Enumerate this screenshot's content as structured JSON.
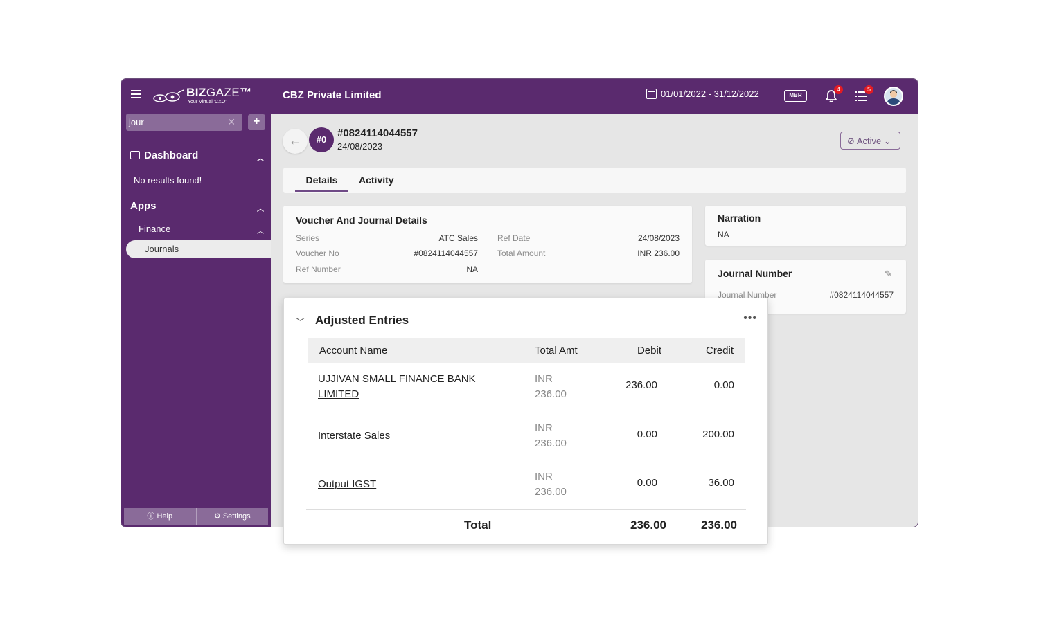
{
  "header": {
    "company": "CBZ Private Limited",
    "date_range": "01/01/2022 - 31/12/2022",
    "mbr_label": "MBR",
    "notif_count": "4",
    "tasks_count": "5",
    "logo_text_bold": "BIZ",
    "logo_text_thin": "GAZE",
    "logo_tagline": "Your Virtual 'CXO'"
  },
  "sidebar": {
    "search_value": "jour",
    "dashboard_label": "Dashboard",
    "no_results": "No results found!",
    "apps_label": "Apps",
    "finance_label": "Finance",
    "journals_label": "Journals",
    "help_label": "Help",
    "settings_label": "Settings"
  },
  "voucher": {
    "badge": "#0",
    "number": "#0824114044557",
    "date": "24/08/2023",
    "status": "Active"
  },
  "tabs": [
    "Details",
    "Activity"
  ],
  "details_card": {
    "title": "Voucher And Journal Details",
    "series_label": "Series",
    "series_value": "ATC Sales",
    "voucher_no_label": "Voucher No",
    "voucher_no_value": "#0824114044557",
    "ref_number_label": "Ref Number",
    "ref_number_value": "NA",
    "ref_date_label": "Ref Date",
    "ref_date_value": "24/08/2023",
    "total_amount_label": "Total Amount",
    "total_amount_value": "INR 236.00"
  },
  "narration_card": {
    "title": "Narration",
    "value": "NA"
  },
  "journal_card": {
    "title": "Journal Number",
    "label": "Journal Number",
    "value": "#0824114044557"
  },
  "adjusted_entries": {
    "title": "Adjusted Entries",
    "columns": [
      "Account Name",
      "Total Amt",
      "Debit",
      "Credit"
    ],
    "rows": [
      {
        "account": "UJJIVAN SMALL FINANCE BANK LIMITED",
        "currency": "INR",
        "total": "236.00",
        "debit": "236.00",
        "credit": "0.00"
      },
      {
        "account": "Interstate Sales",
        "currency": "INR",
        "total": "236.00",
        "debit": "0.00",
        "credit": "200.00"
      },
      {
        "account": "Output IGST",
        "currency": "INR",
        "total": "236.00",
        "debit": "0.00",
        "credit": "36.00"
      }
    ],
    "total_label": "Total",
    "total_debit": "236.00",
    "total_credit": "236.00"
  }
}
